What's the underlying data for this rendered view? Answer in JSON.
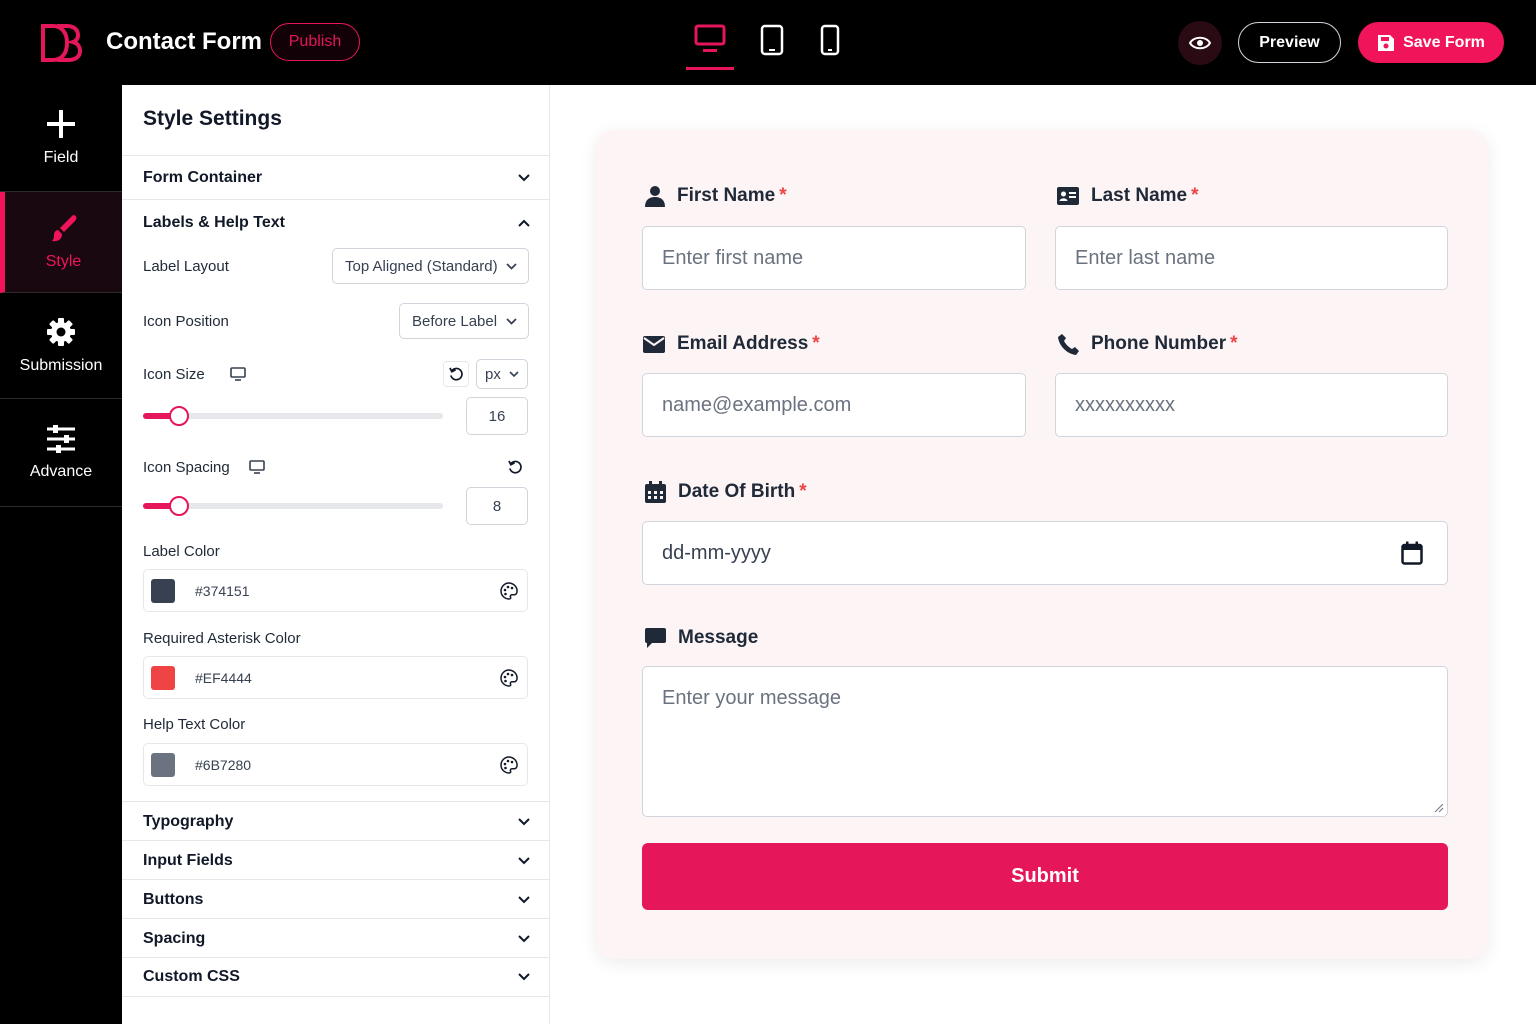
{
  "app": {
    "title": "Contact Form",
    "publish_label": "Publish"
  },
  "header": {
    "preview_label": "Preview",
    "save_label": "Save Form"
  },
  "rail": [
    {
      "label": "Field",
      "icon": "plus-icon"
    },
    {
      "label": "Style",
      "icon": "brush-icon",
      "active": true
    },
    {
      "label": "Submission",
      "icon": "gear-icon"
    },
    {
      "label": "Advance",
      "icon": "sliders-icon"
    }
  ],
  "panel": {
    "title": "Style Settings",
    "sections": {
      "form_container": "Form Container",
      "labels_help": "Labels & Help Text",
      "typography": "Typography",
      "input_fields": "Input Fields",
      "buttons": "Buttons",
      "spacing": "Spacing",
      "custom_css": "Custom CSS"
    },
    "label_layout": {
      "label": "Label Layout",
      "value": "Top Aligned (Standard)"
    },
    "icon_position": {
      "label": "Icon Position",
      "value": "Before Label"
    },
    "icon_size": {
      "label": "Icon Size",
      "unit": "px",
      "value": "16",
      "fraction": 0.12
    },
    "icon_spacing": {
      "label": "Icon Spacing",
      "value": "8",
      "fraction": 0.12
    },
    "label_color": {
      "label": "Label Color",
      "value": "#374151"
    },
    "asterisk_color": {
      "label": "Required Asterisk Color",
      "value": "#EF4444"
    },
    "help_color": {
      "label": "Help Text Color",
      "value": "#6B7280"
    }
  },
  "form": {
    "first_name": {
      "label": "First Name",
      "req": "*",
      "placeholder": "Enter first name"
    },
    "last_name": {
      "label": "Last Name",
      "req": "*",
      "placeholder": "Enter last name"
    },
    "email": {
      "label": "Email Address",
      "req": "*",
      "placeholder": "name@example.com"
    },
    "phone": {
      "label": "Phone Number",
      "req": "*",
      "placeholder": "xxxxxxxxxx"
    },
    "dob": {
      "label": "Date Of Birth",
      "req": "*",
      "placeholder": "dd-mm-yyyy"
    },
    "message": {
      "label": "Message",
      "placeholder": "Enter your message"
    },
    "submit_label": "Submit"
  },
  "colors": {
    "accent": "#E5165A",
    "swatch_label": "#374151",
    "swatch_asterisk": "#EF4444",
    "swatch_help": "#6B7280"
  }
}
